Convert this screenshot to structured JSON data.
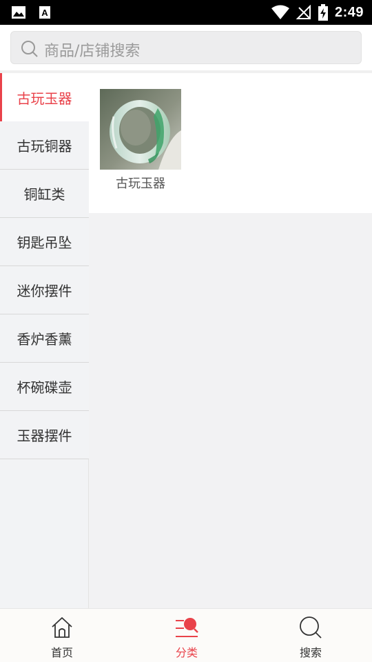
{
  "status_bar": {
    "time": "2:49",
    "icons": [
      "image-icon",
      "text-a-icon",
      "wifi-icon",
      "no-signal-icon",
      "battery-charging-icon"
    ]
  },
  "search": {
    "placeholder": "商品/店铺搜索"
  },
  "sidebar": {
    "items": [
      {
        "label": "古玩玉器",
        "active": true
      },
      {
        "label": "古玩铜器",
        "active": false
      },
      {
        "label": "铜缸类",
        "active": false
      },
      {
        "label": "钥匙吊坠",
        "active": false
      },
      {
        "label": "迷你摆件",
        "active": false
      },
      {
        "label": "香炉香薰",
        "active": false
      },
      {
        "label": "杯碗碟壶",
        "active": false
      },
      {
        "label": "玉器摆件",
        "active": false
      }
    ]
  },
  "content": {
    "products": [
      {
        "label": "古玩玉器",
        "image": "jade-bangle-image"
      }
    ]
  },
  "bottom_nav": {
    "items": [
      {
        "label": "首页",
        "icon": "home-icon",
        "active": false
      },
      {
        "label": "分类",
        "icon": "category-icon",
        "active": true
      },
      {
        "label": "搜索",
        "icon": "search-icon",
        "active": false
      }
    ]
  },
  "colors": {
    "accent": "#e9424a",
    "sidebar_bg": "#f2f3f5",
    "page_bg": "#f2f2f3"
  }
}
